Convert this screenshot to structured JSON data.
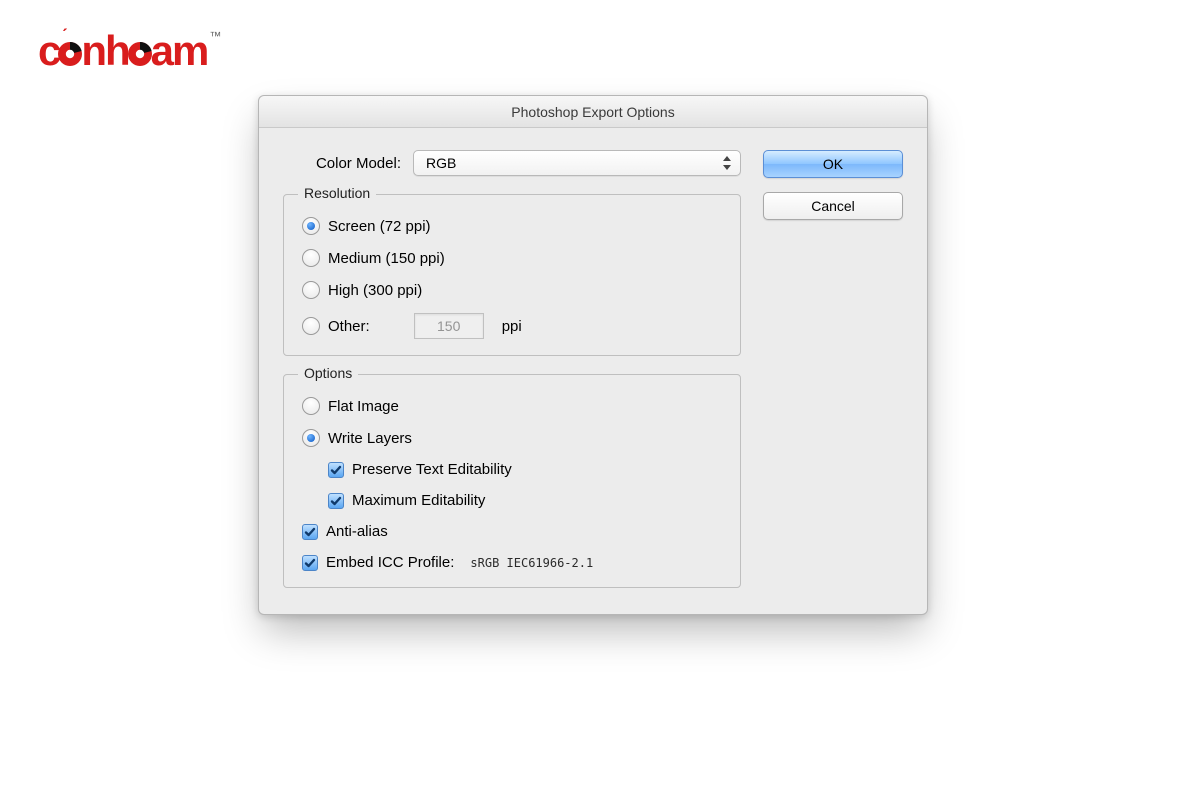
{
  "logo": {
    "text_a": "c",
    "text_b": "nh",
    "text_c": "am",
    "tm": "™"
  },
  "dialog": {
    "title": "Photoshop Export Options",
    "color_model_label": "Color Model:",
    "color_model_value": "RGB",
    "buttons": {
      "ok": "OK",
      "cancel": "Cancel"
    },
    "resolution": {
      "legend": "Resolution",
      "screen": "Screen (72 ppi)",
      "medium": "Medium (150 ppi)",
      "high": "High (300 ppi)",
      "other": "Other:",
      "other_value": "150",
      "ppi": "ppi",
      "selected": "screen"
    },
    "options": {
      "legend": "Options",
      "flat": "Flat Image",
      "write_layers": "Write Layers",
      "preserve_text": "Preserve Text Editability",
      "max_edit": "Maximum Editability",
      "anti_alias": "Anti-alias",
      "embed_icc": "Embed ICC Profile:",
      "icc_name": "sRGB IEC61966-2.1",
      "selected": "write_layers",
      "preserve_text_checked": true,
      "max_edit_checked": true,
      "anti_alias_checked": true,
      "embed_icc_checked": true
    }
  }
}
